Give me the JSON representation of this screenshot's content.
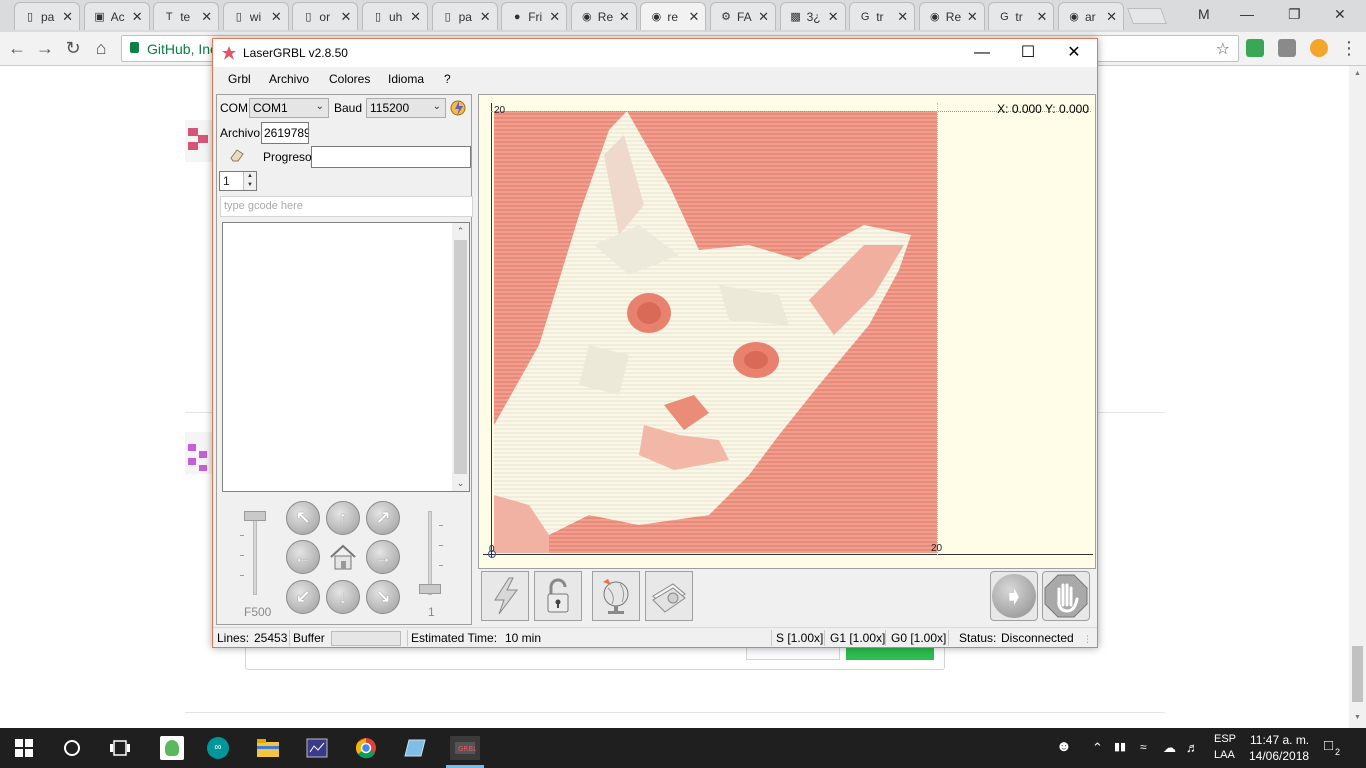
{
  "browser": {
    "tabs": [
      {
        "title": "pa",
        "icon": "document-icon"
      },
      {
        "title": "Ac",
        "icon": "app-icon"
      },
      {
        "title": "te",
        "icon": "t-icon"
      },
      {
        "title": "wi",
        "icon": "document-icon"
      },
      {
        "title": "or",
        "icon": "document-icon"
      },
      {
        "title": "uh",
        "icon": "document-icon"
      },
      {
        "title": "pa",
        "icon": "document-icon"
      },
      {
        "title": "Fri",
        "icon": "red-icon"
      },
      {
        "title": "Re",
        "icon": "github-icon"
      },
      {
        "title": "re",
        "icon": "github-icon"
      },
      {
        "title": "FA",
        "icon": "robot-icon"
      },
      {
        "title": "3¿",
        "icon": "image-icon"
      },
      {
        "title": "tr",
        "icon": "google-icon"
      },
      {
        "title": "Re",
        "icon": "github-icon"
      },
      {
        "title": "tr",
        "icon": "google-icon"
      },
      {
        "title": "ar",
        "icon": "github-icon"
      }
    ],
    "active_tab_index": 9,
    "profile_letter": "M",
    "address_site": "GitHub, Inc"
  },
  "app": {
    "title": "LaserGRBL v2.8.50",
    "menu": [
      "Grbl",
      "Archivo",
      "Colores",
      "Idioma",
      "?"
    ],
    "com_label": "COM",
    "com_value": "COM1",
    "baud_label": "Baud",
    "baud_value": "115200",
    "archivo_label": "Archivo",
    "archivo_value": "2619789",
    "progreso_label": "Progreso",
    "passes_value": "1",
    "gcode_placeholder": "type gcode here",
    "speed_label": "F500",
    "step_label": "1",
    "coord_readout": "X: 0.000 Y: 0.000",
    "axis": {
      "x_min": "0",
      "x_max": "20",
      "y_max": "20"
    },
    "status": {
      "lines_label": "Lines:",
      "lines_value": "25453",
      "buffer_label": "Buffer",
      "est_label": "Estimated Time:",
      "est_value": "10 min",
      "s_override": "S [1.00x]",
      "g1_override": "G1 [1.00x]",
      "g0_override": "G0 [1.00x]",
      "status_label": "Status:",
      "status_value": "Disconnected"
    }
  },
  "taskbar": {
    "lang_top": "ESP",
    "lang_bottom": "LAA",
    "time": "11:47 a. m.",
    "date": "14/06/2018",
    "notifications": "2"
  },
  "colors": {
    "accent": "#e27a5a",
    "engrave": "#e8826e",
    "canvas": "#fffde7"
  }
}
